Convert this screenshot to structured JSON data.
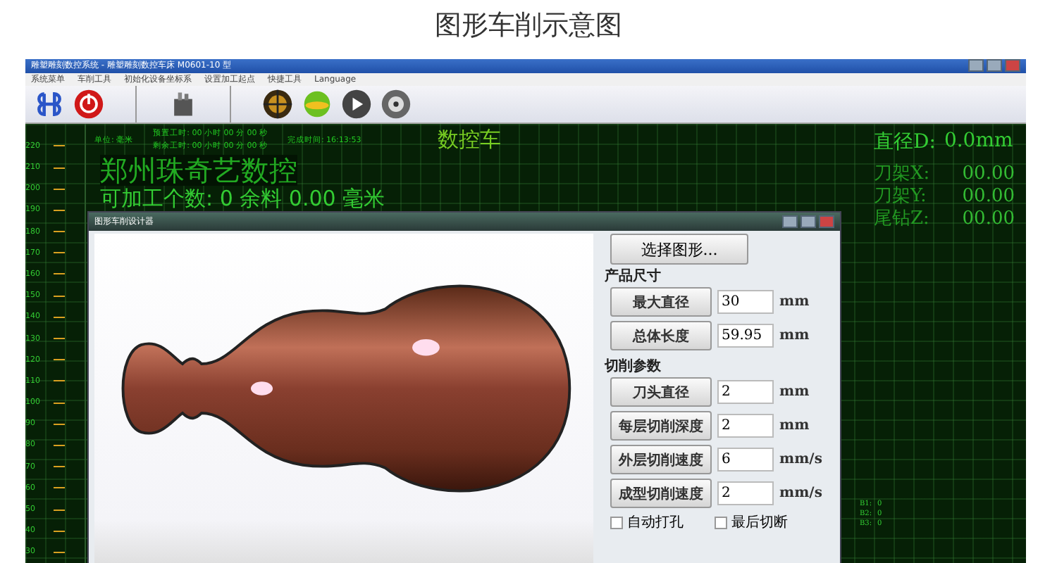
{
  "page_title": "图形车削示意图",
  "window": {
    "title": "雕塑雕刻数控系统 - 雕塑雕刻数控车床 M0601-10 型"
  },
  "menu": [
    "系统菜单",
    "车削工具",
    "初始化设备坐标系",
    "设置加工起点",
    "快捷工具",
    "Language"
  ],
  "status": {
    "unit": "单位: 毫米",
    "preset_time": "预置工时: 00 小时 00 分 00 秒",
    "remaining_time": "剩余工时: 00 小时 00 分 00 秒",
    "finish_time": "完成时间: 16:13:53"
  },
  "heading": "数控车",
  "brand": "郑州珠奇艺数控",
  "count_line": "可加工个数: 0 余料 0.00 毫米",
  "ruler": [
    "220",
    "210",
    "200",
    "190",
    "180",
    "170",
    "160",
    "150",
    "140",
    "130",
    "120",
    "110",
    "100",
    "90",
    "80",
    "70",
    "60",
    "50",
    "40",
    "30"
  ],
  "diameter": {
    "label": "直径D:",
    "value": "0.0mm"
  },
  "axes": [
    {
      "label": "刀架X:",
      "value": "00.00"
    },
    {
      "label": "刀架Y:",
      "value": "00.00"
    },
    {
      "label": "尾钻Z:",
      "value": "00.00"
    }
  ],
  "counters": [
    {
      "label": "B1:",
      "value": "0"
    },
    {
      "label": "B2:",
      "value": "0"
    },
    {
      "label": "B3:",
      "value": "0"
    }
  ],
  "dialog": {
    "title": "图形车削设计器",
    "select_button": "选择图形...",
    "sections": [
      {
        "title": "产品尺寸",
        "params": [
          {
            "label": "最大直径",
            "value": "30",
            "unit": "mm"
          },
          {
            "label": "总体长度",
            "value": "59.95",
            "unit": "mm"
          }
        ]
      },
      {
        "title": "切削参数",
        "params": [
          {
            "label": "刀头直径",
            "value": "2",
            "unit": "mm"
          },
          {
            "label": "每层切削深度",
            "value": "2",
            "unit": "mm"
          },
          {
            "label": "外层切削速度",
            "value": "6",
            "unit": "mm/s"
          },
          {
            "label": "成型切削速度",
            "value": "2",
            "unit": "mm/s"
          }
        ]
      }
    ],
    "options": [
      {
        "label": "自动打孔",
        "checked": false
      },
      {
        "label": "最后切断",
        "checked": false
      }
    ]
  }
}
